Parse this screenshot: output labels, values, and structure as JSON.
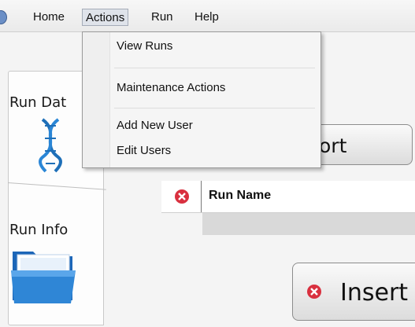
{
  "menubar": {
    "items": [
      {
        "label": "Home"
      },
      {
        "label": "Actions",
        "active": true
      },
      {
        "label": "Run"
      },
      {
        "label": "Help"
      }
    ]
  },
  "actions_menu": {
    "items": [
      "View Runs",
      "Maintenance Actions",
      "Add New User",
      "Edit Users"
    ]
  },
  "tabs": [
    {
      "label": "Run Dat",
      "icon": "dna-icon"
    },
    {
      "label": "Run Info",
      "icon": "folder-icon"
    }
  ],
  "import_button": {
    "label": "ort"
  },
  "runs_grid": {
    "columns": [
      "Run Name"
    ],
    "status_icon": "error-icon"
  },
  "insert_button": {
    "label": "Insert",
    "icon": "error-icon"
  },
  "colors": {
    "error_red": "#d9303f",
    "dna_blue": "#1e6fb8",
    "folder_blue": "#2f86d6"
  }
}
